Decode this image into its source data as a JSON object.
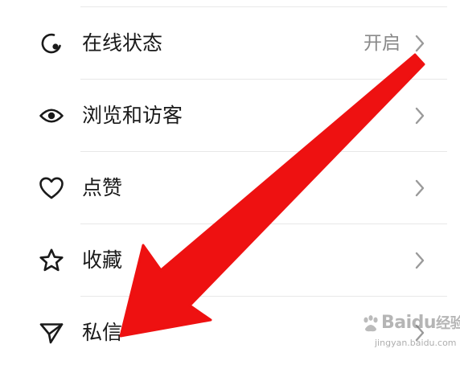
{
  "settings": {
    "items": [
      {
        "label": "在线状态",
        "value": "开启",
        "icon": "online-status-icon"
      },
      {
        "label": "浏览和访客",
        "value": "",
        "icon": "eye-icon"
      },
      {
        "label": "点赞",
        "value": "",
        "icon": "heart-icon"
      },
      {
        "label": "收藏",
        "value": "",
        "icon": "star-icon"
      },
      {
        "label": "私信",
        "value": "",
        "icon": "paper-plane-icon"
      }
    ]
  },
  "annotation": {
    "arrow_color": "#ee1111",
    "arrow_target": "私信"
  },
  "watermark": {
    "brand": "Bai",
    "brand_suffix": "du",
    "brand_tail": "经验",
    "url": "jingyan.baidu.com"
  },
  "colors": {
    "text": "#1a1a1a",
    "secondary_text": "#8a8a8a",
    "divider": "#e8e8e8",
    "chevron": "#9a9a9a"
  }
}
